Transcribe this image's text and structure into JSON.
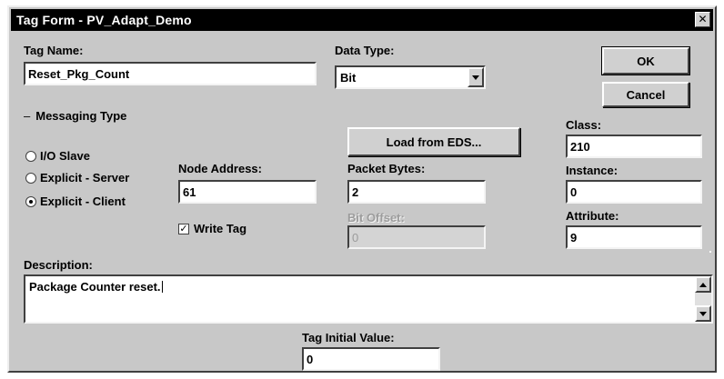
{
  "window": {
    "title": "Tag Form - PV_Adapt_Demo",
    "close_icon": "close-icon"
  },
  "tag_name": {
    "label": "Tag Name:",
    "value": "Reset_Pkg_Count"
  },
  "data_type": {
    "label": "Data Type:",
    "value": "Bit"
  },
  "buttons": {
    "ok": "OK",
    "cancel": "Cancel",
    "load_eds": "Load from EDS..."
  },
  "messaging": {
    "label": "Messaging Type",
    "options": [
      "I/O Slave",
      "Explicit - Server",
      "Explicit - Client"
    ],
    "selected": "Explicit - Client"
  },
  "node_address": {
    "label": "Node Address:",
    "value": "61"
  },
  "packet_bytes": {
    "label": "Packet Bytes:",
    "value": "2"
  },
  "bit_offset": {
    "label": "Bit Offset:",
    "value": "0"
  },
  "write_tag": {
    "label": "Write Tag",
    "checked": true
  },
  "class": {
    "label": "Class:",
    "value": "210"
  },
  "instance": {
    "label": "Instance:",
    "value": "0"
  },
  "attribute": {
    "label": "Attribute:",
    "value": "9"
  },
  "description": {
    "label": "Description:",
    "value": "Package Counter reset."
  },
  "tag_initial_value": {
    "label": "Tag Initial Value:",
    "value": "0"
  },
  "colors": {
    "titlebar": "#000000",
    "face": "#c8c8c8",
    "field": "#ffffff",
    "disabled_text": "#9c9c9c"
  }
}
